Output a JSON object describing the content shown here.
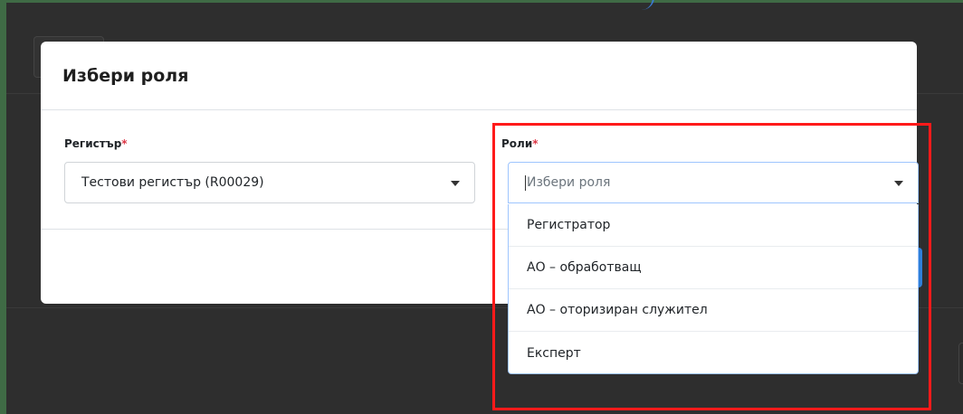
{
  "modal": {
    "title": "Избери роля"
  },
  "register_field": {
    "label": "Регистър",
    "required_mark": "*",
    "value": "Тестови регистър (R00029)"
  },
  "roles_field": {
    "label": "Роли",
    "required_mark": "*",
    "placeholder": "Избери роля",
    "options": [
      "Регистратор",
      "АО – обработващ",
      "АО – оторизиран служител",
      "Експерт"
    ]
  },
  "colors": {
    "required": "#dc3545",
    "highlight": "#ff1a1a",
    "focus_border": "#9ec5fe",
    "primary": "#2f7fd8"
  }
}
